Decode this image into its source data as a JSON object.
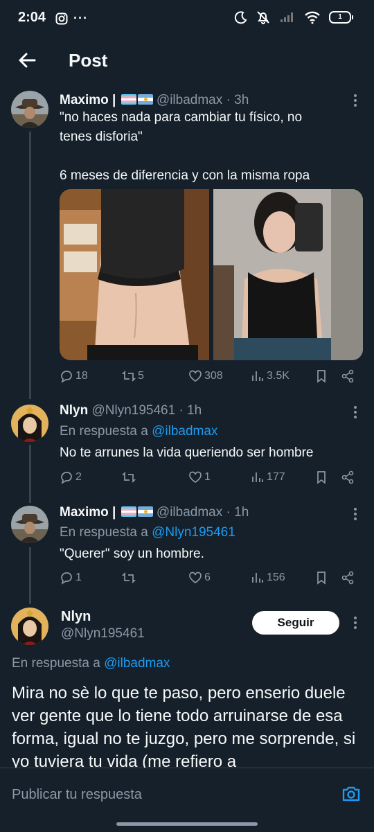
{
  "status_bar": {
    "time": "2:04",
    "battery": "1"
  },
  "header": {
    "title": "Post"
  },
  "tweets": [
    {
      "name": "Maximo |",
      "handle": "@ilbadmax",
      "time": "· 3h",
      "text_lines": [
        "\"no haces nada para cambiar tu físico, no",
        "tenes disforia\"",
        "",
        "6 meses de diferencia y con la misma ropa"
      ],
      "stats": {
        "replies": "18",
        "retweets": "5",
        "likes": "308",
        "views": "3.5K"
      }
    },
    {
      "name": "Nlyn",
      "handle": "@Nlyn195461",
      "time": "· 1h",
      "reply_prefix": "En respuesta a",
      "reply_target": "@ilbadmax",
      "text": "No te arrunes la vida queriendo ser hombre",
      "stats": {
        "replies": "2",
        "retweets": "",
        "likes": "1",
        "views": "177"
      }
    },
    {
      "name": "Maximo |",
      "handle": "@ilbadmax",
      "time": "· 1h",
      "reply_prefix": "En respuesta a",
      "reply_target": "@Nlyn195461",
      "text": "\"Querer\" soy un hombre.",
      "stats": {
        "replies": "1",
        "retweets": "",
        "likes": "6",
        "views": "156"
      }
    }
  ],
  "main_tweet": {
    "name": "Nlyn",
    "handle": "@Nlyn195461",
    "follow_label": "Seguir",
    "reply_prefix": "En respuesta a",
    "reply_target": "@ilbadmax",
    "text": "Mira no sè lo que te paso, pero enserio duele ver gente que lo tiene todo arruinarse de esa forma, igual no te juzgo, pero me sorprende, si yo tuviera tu vida (me refiero a"
  },
  "reply_bar": {
    "placeholder": "Publicar tu respuesta"
  },
  "colors": {
    "background": "#15202b",
    "accent": "#1d9bf0",
    "muted": "#8b98a5"
  }
}
